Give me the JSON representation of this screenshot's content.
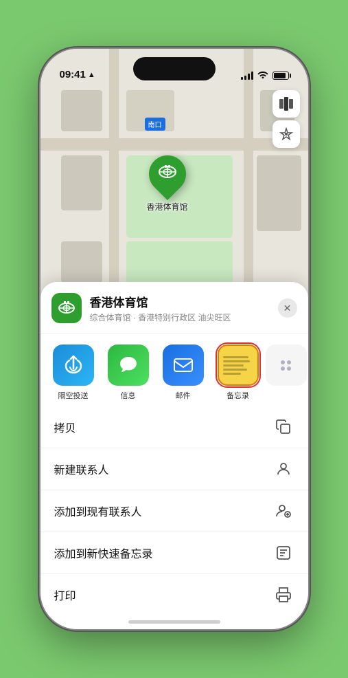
{
  "status_bar": {
    "time": "09:41",
    "location_icon": "▲"
  },
  "map": {
    "label": "南口",
    "stadium_label": "香港体育馆",
    "controls": {
      "map_icon": "🗺",
      "location_icon": "➤"
    }
  },
  "venue": {
    "name": "香港体育馆",
    "subtitle": "综合体育馆 · 香港特别行政区 油尖旺区",
    "close_label": "✕"
  },
  "share_apps": [
    {
      "id": "airdrop",
      "label": "隔空投送",
      "icon": "airdrop"
    },
    {
      "id": "messages",
      "label": "信息",
      "icon": "messages"
    },
    {
      "id": "mail",
      "label": "邮件",
      "icon": "mail"
    },
    {
      "id": "notes",
      "label": "备忘录",
      "icon": "notes",
      "selected": true
    }
  ],
  "action_items": [
    {
      "id": "copy",
      "label": "拷贝"
    },
    {
      "id": "new-contact",
      "label": "新建联系人"
    },
    {
      "id": "add-existing",
      "label": "添加到现有联系人"
    },
    {
      "id": "add-notes",
      "label": "添加到新快速备忘录"
    },
    {
      "id": "print",
      "label": "打印"
    }
  ]
}
